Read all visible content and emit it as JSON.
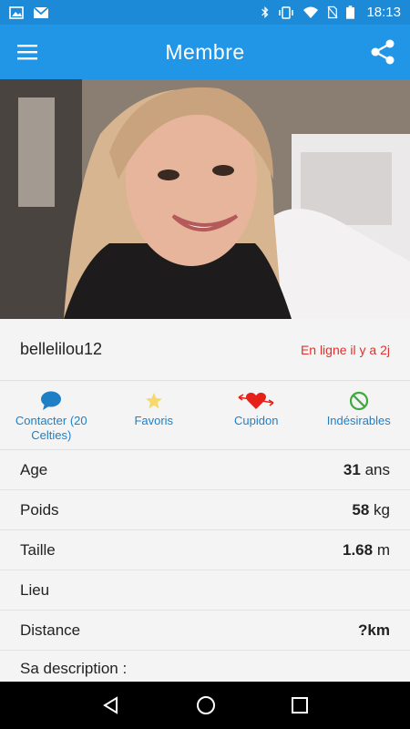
{
  "status_bar": {
    "time": "18:13",
    "icons_left": [
      "image-icon",
      "gmail-icon"
    ],
    "icons_right": [
      "bluetooth-icon",
      "vibrate-icon",
      "wifi-icon",
      "no-sim-icon",
      "battery-icon"
    ]
  },
  "app_bar": {
    "title": "Membre",
    "menu_icon": "hamburger-menu-icon",
    "share_icon": "share-icon"
  },
  "profile": {
    "username": "bellelilou12",
    "online_status": "En ligne il y a 2j"
  },
  "actions": [
    {
      "label": "Contacter (20 Celties)",
      "icon": "chat-bubble-icon",
      "color": "#1f7fc4"
    },
    {
      "label": "Favoris",
      "icon": "star-icon",
      "color": "#f5d96b"
    },
    {
      "label": "Cupidon",
      "icon": "heart-arrow-icon",
      "color": "#e8201a"
    },
    {
      "label": "Indésirables",
      "icon": "block-icon",
      "color": "#3caa3c"
    }
  ],
  "details": [
    {
      "label": "Age",
      "value": "31",
      "unit": "ans"
    },
    {
      "label": "Poids",
      "value": "58",
      "unit": "kg"
    },
    {
      "label": "Taille",
      "value": "1.68",
      "unit": "m"
    },
    {
      "label": "Lieu",
      "value": "",
      "unit": ""
    },
    {
      "label": "Distance",
      "value": "?km",
      "unit": ""
    }
  ],
  "description_label": "Sa description :",
  "colors": {
    "status_bar": "#1c8ad6",
    "app_bar": "#2196e6",
    "online_red": "#e0302b",
    "action_blue": "#1f7fc4"
  }
}
